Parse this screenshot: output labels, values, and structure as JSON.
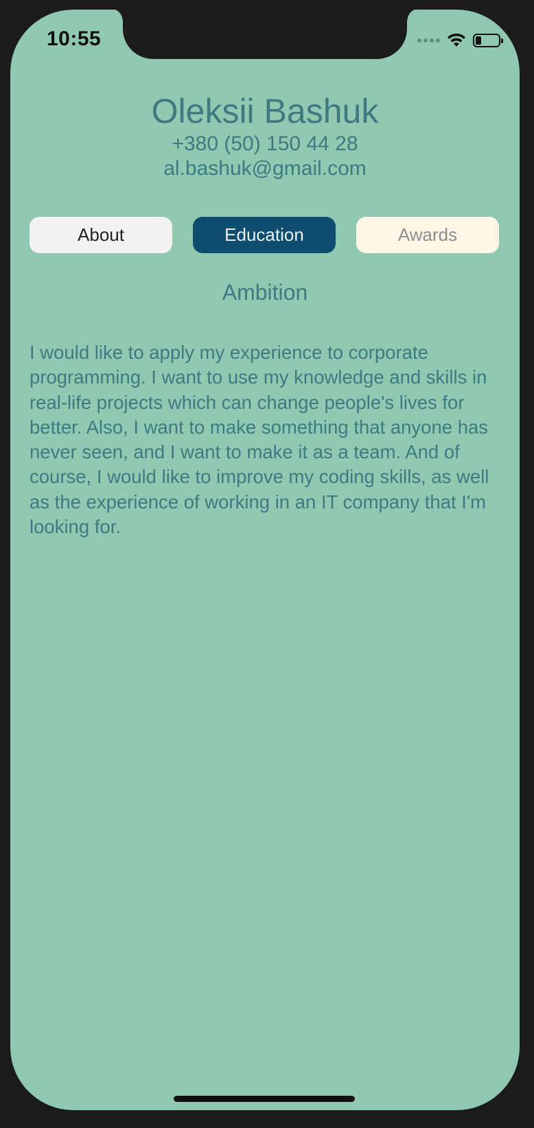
{
  "status_bar": {
    "time": "10:55",
    "signal_icon": "cellular-dots-icon",
    "wifi_icon": "wifi-icon",
    "battery_icon": "battery-icon",
    "battery_level": 0.25
  },
  "profile": {
    "name": "Oleksii Bashuk",
    "phone": "+380 (50) 150 44 28",
    "email": "al.bashuk@gmail.com"
  },
  "tabs": [
    {
      "label": "About",
      "selected": false
    },
    {
      "label": "Education",
      "selected": true
    },
    {
      "label": "Awards",
      "selected": false
    }
  ],
  "section": {
    "title": "Ambition",
    "body": "I would like to apply my experience to corporate programming. I want to use my knowledge and skills in real-life projects which can change people's lives for better. Also, I want to make something that anyone has never seen, and I want to make it as a team. And of course, I would like to improve my coding skills, as well as the experience of working in an IT company that I'm looking for."
  },
  "colors": {
    "background": "#91c8b2",
    "text_accent": "#3f7a80",
    "tab_about_bg": "#f2f2f2",
    "tab_education_bg": "#0e4d6d",
    "tab_awards_bg": "#fdf5e6"
  }
}
